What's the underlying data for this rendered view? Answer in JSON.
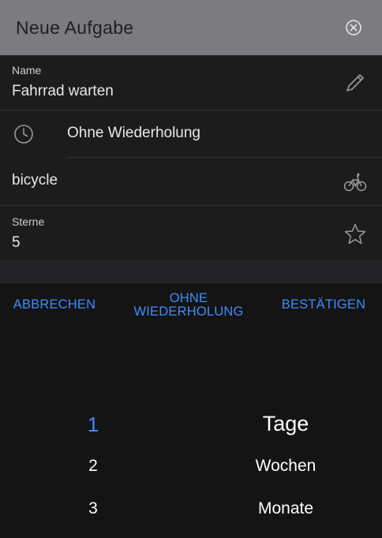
{
  "header": {
    "title": "Neue Aufgabe",
    "close_icon": "close-circle-icon"
  },
  "form": {
    "name": {
      "label": "Name",
      "value": "Fahrrad warten",
      "icon": "pencil-icon"
    },
    "repeat": {
      "value": "Ohne Wiederholung",
      "icon": "clock-icon"
    },
    "icon_field": {
      "value": "bicycle",
      "icon": "bicycle-icon"
    },
    "stars": {
      "label": "Sterne",
      "value": "5",
      "icon": "star-icon"
    }
  },
  "picker": {
    "cancel": "ABBRECHEN",
    "no_repeat_line1": "OHNE",
    "no_repeat_line2": "WIEDERHOLUNG",
    "confirm": "BESTÄTIGEN",
    "numbers": [
      "1",
      "2",
      "3"
    ],
    "units": [
      "Tage",
      "Wochen",
      "Monate"
    ],
    "selected_number": "1",
    "selected_unit": "Tage"
  },
  "colors": {
    "accent": "#3f8cff",
    "header_bg": "#7b7c80",
    "background": "#141414"
  }
}
